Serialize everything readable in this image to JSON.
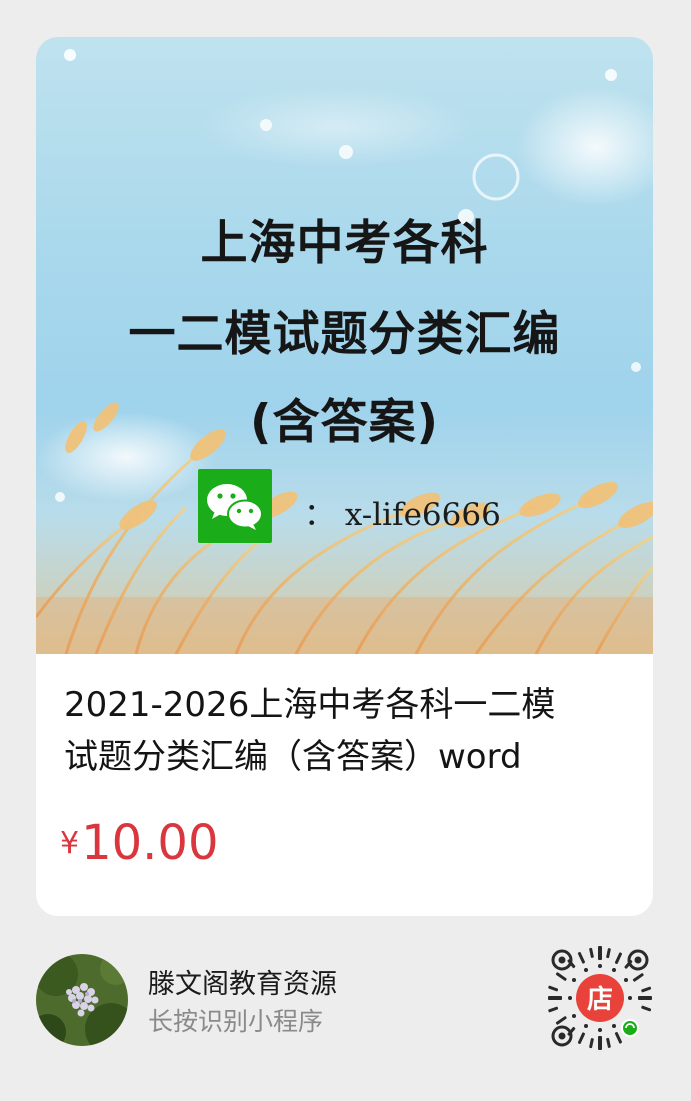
{
  "card": {
    "cover": {
      "title_lines": [
        "上海中考各科",
        "一二模试题分类汇编",
        "(含答案)"
      ],
      "wechat_label": "： x-life6666",
      "wechat_icon": "wechat-icon"
    },
    "product_title_line1": "2021-2026上海中考各科一二模",
    "product_title_line2": "试题分类汇编（含答案）word",
    "price": {
      "currency": "¥",
      "amount": "10.00"
    }
  },
  "footer": {
    "shop_name": "滕文阁教育资源",
    "hint": "长按识别小程序",
    "avatar_icon": "flower-avatar",
    "qr_icon": "mini-program-code",
    "qr_center_label": "店"
  },
  "colors": {
    "price": "#d9363e",
    "wechat_green": "#1aad19",
    "qr_center": "#e8423a"
  }
}
